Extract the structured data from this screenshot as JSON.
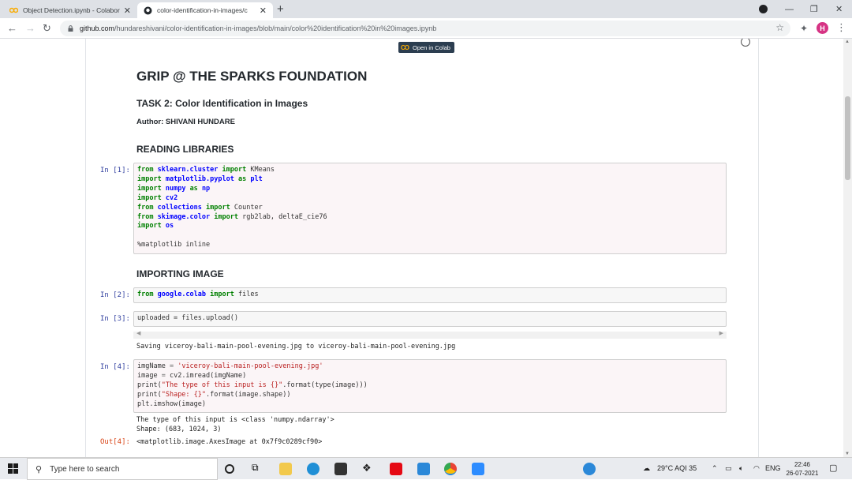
{
  "browser": {
    "tabs": [
      {
        "title": "Object Detection.ipynb - Colabor",
        "active": false
      },
      {
        "title": "color-identification-in-images/c",
        "active": true
      }
    ],
    "url_domain": "github.com",
    "url_path": "/hundareshivani/color-identification-in-images/blob/main/color%20identification%20in%20images.ipynb",
    "profile_initial": "H"
  },
  "notebook": {
    "colab_badge": "Open in Colab",
    "title": "GRIP @ THE SPARKS FOUNDATION",
    "task": "TASK 2: Color Identification in Images",
    "author": "Author: SHIVANI HUNDARE",
    "section_reading": "READING LIBRARIES",
    "section_importing": "IMPORTING IMAGE",
    "cells": [
      {
        "prompt": "In [1]:",
        "lines": [
          "from sklearn.cluster import KMeans",
          "import matplotlib.pyplot as plt",
          "import numpy as np",
          "import cv2",
          "from collections import Counter",
          "from skimage.color import rgb2lab, deltaE_cie76",
          "import os",
          "",
          "%matplotlib inline"
        ]
      },
      {
        "prompt": "In [2]:",
        "lines": [
          "from google.colab import files"
        ]
      },
      {
        "prompt": "In [3]:",
        "lines": [
          "uploaded = files.upload()"
        ],
        "output": "Saving viceroy-bali-main-pool-evening.jpg to viceroy-bali-main-pool-evening.jpg"
      },
      {
        "prompt": "In [4]:",
        "lines": [
          "imgName = 'viceroy-bali-main-pool-evening.jpg'",
          "image = cv2.imread(imgName)",
          "print(\"The type of this input is {}\".format(type(image)))",
          "print(\"Shape: {}\".format(image.shape))",
          "plt.imshow(image)"
        ],
        "output": "The type of this input is <class 'numpy.ndarray'>\nShape: (683, 1024, 3)"
      }
    ],
    "out_prompt": "Out[4]:",
    "out_value": "<matplotlib.image.AxesImage at 0x7f9c0289cf90>"
  },
  "taskbar": {
    "search_placeholder": "Type here to search",
    "weather": "29°C  AQI 35",
    "language": "ENG",
    "time": "22:46",
    "date": "26-07-2021"
  },
  "colors": {
    "accent_github": "#24292e",
    "colab_orange": "#f9ab00",
    "prompt_blue": "#303f9f",
    "prompt_red": "#d84315"
  }
}
